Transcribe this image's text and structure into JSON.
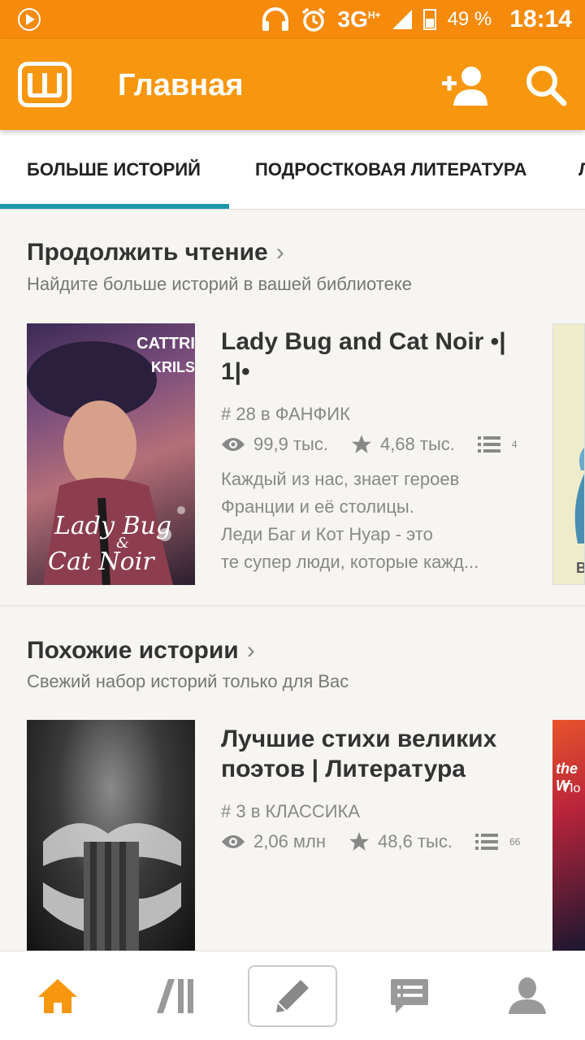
{
  "status_bar": {
    "network": "3G",
    "network_sup": "H+",
    "battery": "49 %",
    "time": "18:14"
  },
  "app_bar": {
    "title": "Главная",
    "accent_color": "#f7970f"
  },
  "tabs": [
    {
      "label": "БОЛЬШЕ ИСТОРИЙ",
      "active": true
    },
    {
      "label": "ПОДРОСТКОВАЯ ЛИТЕРАТУРА",
      "active": false
    }
  ],
  "sections": [
    {
      "title": "Продолжить чтение",
      "subtitle": "Найдите больше историй в вашей библиотеке",
      "story": {
        "cover_text_top": "CATTRI",
        "cover_text_top2": "KRILS",
        "cover_script_1": "Lady Bug",
        "cover_script_2": "&",
        "cover_script_3": "Cat Noir",
        "title_line1": "Lady Bug and Cat Noir •|",
        "title_line2": "1|•",
        "rank": "# 28 в ФАНФИК",
        "views": "99,9 тыс.",
        "votes": "4,68 тыс.",
        "parts": "4",
        "description": [
          "Каждый из нас, знает героев",
          "Франции и  её столицы.",
          "Леди Баг  и Кот Нуар - это",
          "те супер люди, которые кажд..."
        ]
      },
      "peek_cover_text": "В"
    },
    {
      "title": "Похожие истории",
      "subtitle": "Свежий набор историй только для Вас",
      "story": {
        "title_line1": "Лучшие стихи великих",
        "title_line2": "поэтов | Литература",
        "rank": "# 3 в КЛАССИКА",
        "views": "2,06 млн",
        "votes": "48,6 тыс.",
        "parts": "66"
      },
      "peek_cover_text": "the W",
      "peek_cover_text2": "По"
    }
  ],
  "bottom_nav": [
    {
      "icon": "home-icon",
      "active": true
    },
    {
      "icon": "library-icon",
      "active": false
    },
    {
      "icon": "write-icon",
      "active": false
    },
    {
      "icon": "messages-icon",
      "active": false
    },
    {
      "icon": "profile-icon",
      "active": false
    }
  ]
}
